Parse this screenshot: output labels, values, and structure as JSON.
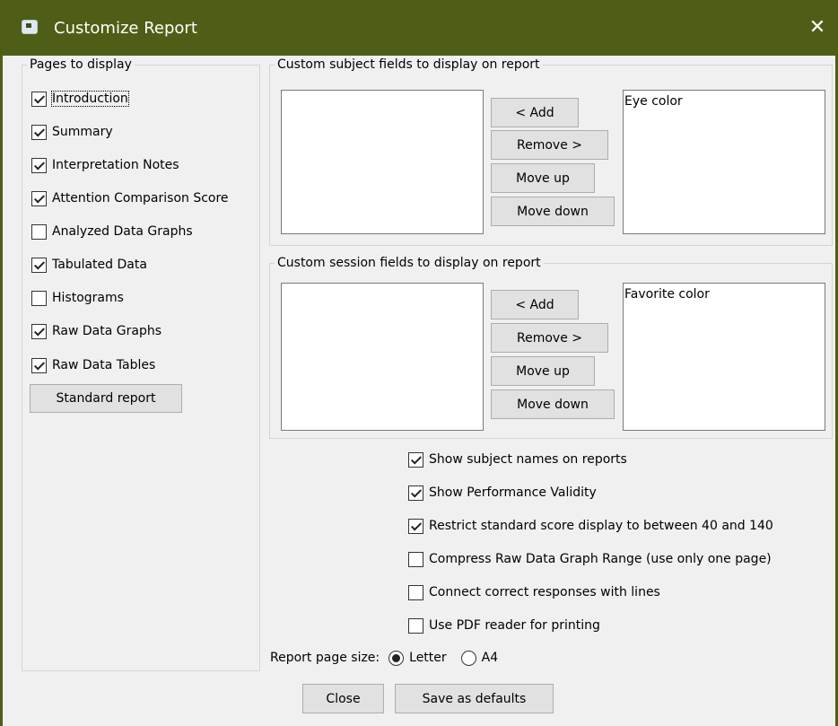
{
  "window": {
    "title": "Customize Report",
    "close_glyph": "✕",
    "title_icon": "app-icon"
  },
  "pages_group": {
    "legend": "Pages to display",
    "items": [
      {
        "label": "Introduction",
        "checked": true
      },
      {
        "label": "Summary",
        "checked": true
      },
      {
        "label": "Interpretation Notes",
        "checked": true
      },
      {
        "label": "Attention Comparison Score",
        "checked": true
      },
      {
        "label": "Analyzed Data Graphs",
        "checked": false
      },
      {
        "label": "Tabulated Data",
        "checked": true
      },
      {
        "label": "Histograms",
        "checked": false
      },
      {
        "label": "Raw Data Graphs",
        "checked": true
      },
      {
        "label": "Raw Data Tables",
        "checked": true
      }
    ],
    "standard_button": "Standard report"
  },
  "subject_group": {
    "legend": "Custom subject fields to display on report",
    "available": [],
    "selected": [
      "Eye color"
    ],
    "add": "< Add",
    "remove": "Remove >",
    "up": "Move up",
    "down": "Move down"
  },
  "session_group": {
    "legend": "Custom session fields to display on report",
    "available": [],
    "selected": [
      "Favorite color"
    ],
    "add": "< Add",
    "remove": "Remove >",
    "up": "Move up",
    "down": "Move down"
  },
  "options": [
    {
      "label": "Show subject names on reports",
      "checked": true
    },
    {
      "label": "Show Performance Validity",
      "checked": true
    },
    {
      "label": "Restrict standard score display to between 40 and 140",
      "checked": true
    },
    {
      "label": "Compress Raw Data Graph Range (use only one page)",
      "checked": false
    },
    {
      "label": "Connect correct responses with lines",
      "checked": false
    },
    {
      "label": "Use PDF reader for printing",
      "checked": false
    }
  ],
  "page_size": {
    "label": "Report page size:",
    "options": [
      "Letter",
      "A4"
    ],
    "selected": "Letter"
  },
  "footer": {
    "close": "Close",
    "save_defaults": "Save as defaults"
  }
}
